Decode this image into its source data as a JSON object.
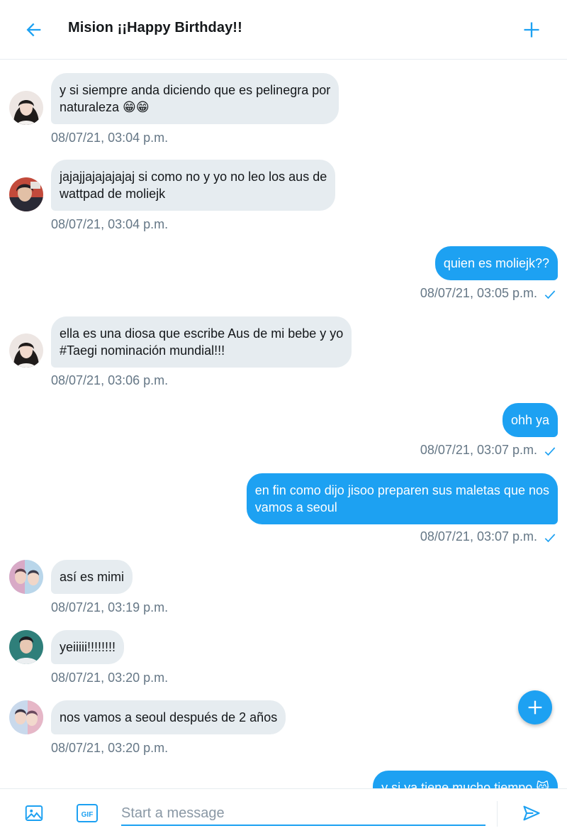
{
  "header": {
    "title": "Mision ¡¡Happy Birthday!!",
    "back_icon": "arrow-left-icon",
    "add_icon": "plus-icon"
  },
  "colors": {
    "accent": "#1da1f2",
    "incoming_bubble": "#e6ecf0",
    "timestamp": "#657786"
  },
  "messages": [
    {
      "direction": "incoming",
      "lines": [
        "y si siempre anda diciendo que es pelinegra por",
        "naturaleza 😁😁"
      ],
      "time": "08/07/21, 03:04 p.m."
    },
    {
      "direction": "incoming",
      "lines": [
        "jajajjajajajajaj si como no y yo no leo los aus  de",
        "wattpad de moliejk"
      ],
      "time": "08/07/21, 03:04 p.m."
    },
    {
      "direction": "outgoing",
      "lines": [
        "quien es moliejk??"
      ],
      "time": "08/07/21, 03:05 p.m."
    },
    {
      "direction": "incoming",
      "lines": [
        "ella es una diosa que escribe Aus  de mi bebe y yo",
        "#Taegi nominación mundial!!!"
      ],
      "time": "08/07/21, 03:06 p.m."
    },
    {
      "direction": "outgoing",
      "lines": [
        "ohh ya"
      ],
      "time": "08/07/21, 03:07 p.m."
    },
    {
      "direction": "outgoing",
      "lines": [
        "en fin como dijo jisoo preparen sus maletas que nos",
        "vamos a seoul"
      ],
      "time": "08/07/21, 03:07 p.m."
    },
    {
      "direction": "incoming",
      "lines": [
        "así es mimi"
      ],
      "time": "08/07/21, 03:19 p.m."
    },
    {
      "direction": "incoming",
      "lines": [
        "yeiiiii!!!!!!!!"
      ],
      "time": "08/07/21, 03:20 p.m."
    },
    {
      "direction": "incoming",
      "lines": [
        "nos vamos a seoul después de 2 años"
      ],
      "time": "08/07/21, 03:20 p.m."
    },
    {
      "direction": "outgoing",
      "lines": [
        "y si ya tiene mucho tiempo 😸"
      ],
      "time": ""
    }
  ],
  "composer": {
    "placeholder": "Start a message",
    "image_icon": "image-icon",
    "gif_icon": "gif-icon",
    "gif_label": "GIF",
    "send_icon": "send-icon"
  },
  "fab_icon": "plus-icon"
}
